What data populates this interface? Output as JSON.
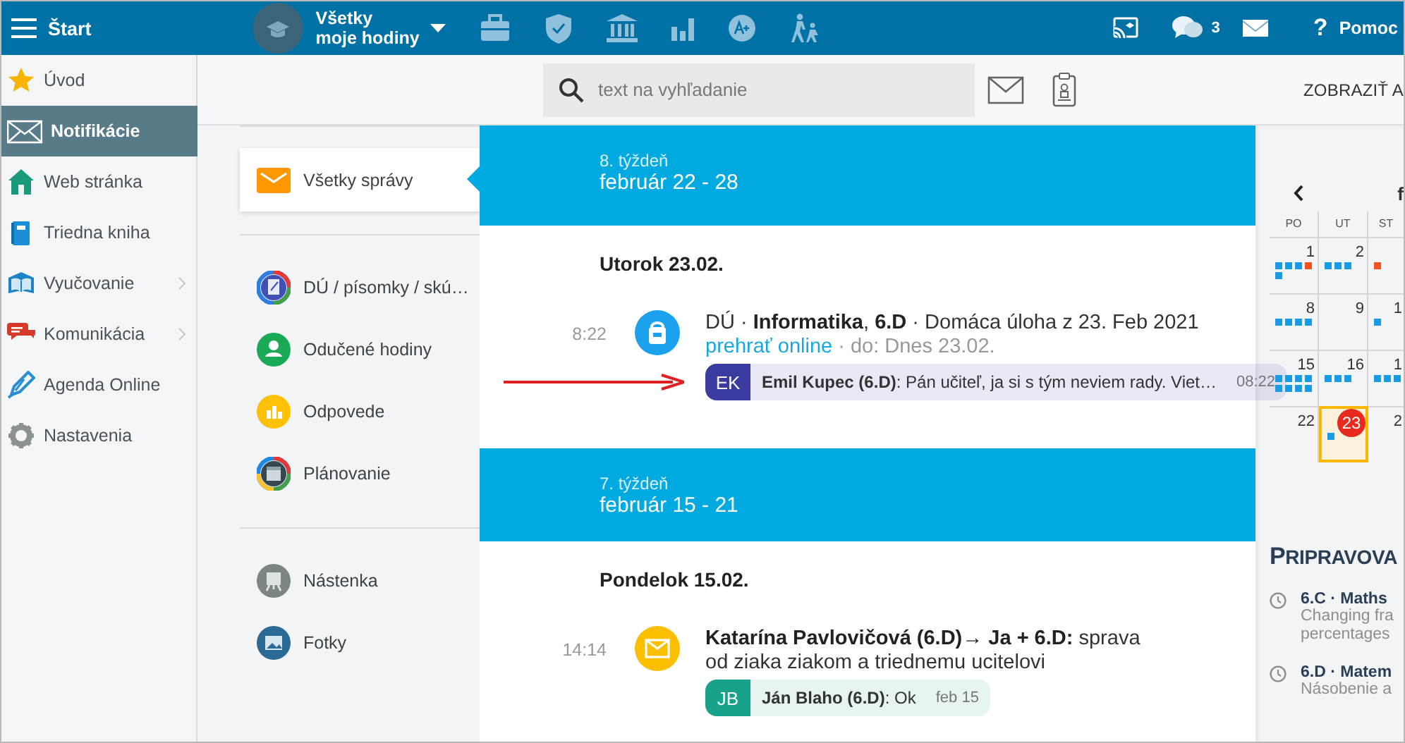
{
  "topbar": {
    "menu_label": "Štart",
    "course": {
      "line1": "Všetky",
      "line2": "moje hodiny"
    },
    "chat_count": "3",
    "help_icon": "?",
    "help_label": "Pomoc"
  },
  "sidebar": {
    "items": [
      {
        "label": "Úvod",
        "selected": false,
        "has_submenu": false
      },
      {
        "label": "Notifikácie",
        "selected": true,
        "has_submenu": false
      },
      {
        "label": "Web stránka",
        "selected": false,
        "has_submenu": false
      },
      {
        "label": "Triedna kniha",
        "selected": false,
        "has_submenu": false
      },
      {
        "label": "Vyučovanie",
        "selected": false,
        "has_submenu": true
      },
      {
        "label": "Komunikácia",
        "selected": false,
        "has_submenu": true
      },
      {
        "label": "Agenda Online",
        "selected": false,
        "has_submenu": false
      },
      {
        "label": "Nastavenia",
        "selected": false,
        "has_submenu": false
      }
    ]
  },
  "toolbar": {
    "search": {
      "placeholder": "text na vyhľadanie"
    },
    "show_all": "ZOBRAZIŤ A"
  },
  "filters": {
    "groups": [
      {
        "items": [
          {
            "label": "Všetky správy",
            "selected": true
          }
        ]
      },
      {
        "items": [
          {
            "label": "DÚ / písomky / skú…",
            "selected": false
          },
          {
            "label": "Odučené hodiny",
            "selected": false
          },
          {
            "label": "Odpovede",
            "selected": false
          },
          {
            "label": "Plánovanie",
            "selected": false
          }
        ]
      },
      {
        "items": [
          {
            "label": "Nástenka",
            "selected": false
          },
          {
            "label": "Fotky",
            "selected": false
          }
        ]
      }
    ]
  },
  "feed": {
    "weeks": [
      {
        "week": "8. týždeň",
        "range": "február 22 - 28",
        "days": [
          {
            "day": "Utorok 23.02.",
            "entries": [
              {
                "time": "8:22",
                "kind": "homework",
                "text": "DÚ · **Informatika**, **6.D** · Domáca úloha z 23. Feb 2021",
                "link": "prehrať online",
                "meta": "· do: Dnes 23.02.",
                "highlighted": true,
                "reply": {
                  "initials": "EK",
                  "color": "#3a3aa0",
                  "text": "**Emil Kupec (6.D)**: Pán učiteľ, ja si s tým neviem rady. Viet…",
                  "time": "08:22"
                }
              }
            ]
          }
        ]
      },
      {
        "week": "7. týždeň",
        "range": "február 15 - 21",
        "days": [
          {
            "day": "Pondelok 15.02.",
            "entries": [
              {
                "time": "14:14",
                "kind": "message",
                "text": "**Katarína Pavlovičová (6.D)→ Ja + 6.D:** sprava\nod ziaka ziakom a triednemu ucitelovi",
                "reply": {
                  "initials": "JB",
                  "color": "#17a28b",
                  "text": "**Ján Blaho (6.D)**: Ok",
                  "time": "feb 15"
                }
              }
            ]
          }
        ]
      }
    ]
  },
  "calendar": {
    "month": "f",
    "weekdays": [
      "PO",
      "UT",
      "ST"
    ],
    "weeks": [
      [
        {
          "day": "1",
          "today": false,
          "dots": [
            {
              "color": "#1a9be6"
            },
            {
              "color": "#1a9be6"
            },
            {
              "color": "#1a9be6"
            },
            {
              "color": "#f4511e"
            },
            {
              "color": "#1a9be6"
            }
          ]
        },
        {
          "day": "2",
          "today": false,
          "dots": [
            {
              "color": "#1a9be6"
            },
            {
              "color": "#1a9be6"
            },
            {
              "color": "#1a9be6"
            }
          ]
        },
        {
          "dots": [
            {
              "color": "#f4511e"
            }
          ]
        }
      ],
      [
        {
          "day": "8",
          "today": false,
          "dots": [
            {
              "color": "#1a9be6"
            },
            {
              "color": "#1a9be6"
            },
            {
              "color": "#1a9be6"
            },
            {
              "color": "#1a9be6"
            }
          ]
        },
        {
          "day": "9",
          "today": false
        },
        {
          "day": "1",
          "today": false,
          "dots": [
            {
              "color": "#1a9be6"
            }
          ]
        }
      ],
      [
        {
          "day": "15",
          "today": false,
          "dots": [
            {
              "color": "#1a9be6"
            },
            {
              "color": "#1a9be6"
            },
            {
              "color": "#1a9be6"
            },
            {
              "color": "#1a9be6"
            },
            {
              "color": "#1a9be6"
            },
            {
              "color": "#1a9be6"
            },
            {
              "color": "#1a9be6"
            },
            {
              "color": "#1a9be6"
            }
          ]
        },
        {
          "day": "16",
          "today": false,
          "dots": [
            {
              "color": "#1a9be6"
            },
            {
              "color": "#1a9be6"
            },
            {
              "color": "#1a9be6"
            }
          ]
        },
        {
          "day": "1",
          "today": false,
          "dots": [
            {
              "color": "#1a9be6"
            },
            {
              "color": "#1a9be6"
            },
            {
              "color": "#1a9be6"
            }
          ]
        }
      ],
      [
        {
          "day": "22",
          "today": false
        },
        {
          "day": "23",
          "today": true,
          "dots": [
            {
              "color": "#1a9be6"
            }
          ]
        },
        {
          "day": "2",
          "today": false
        }
      ]
    ]
  },
  "upcoming": {
    "title": "PRIPRAVOVA",
    "items": [
      {
        "heading": "6.C · Maths",
        "lines": [
          "Changing fra",
          "percentages"
        ]
      },
      {
        "heading": "6.D · Matem",
        "lines": [
          "Násobenie a"
        ]
      }
    ]
  }
}
